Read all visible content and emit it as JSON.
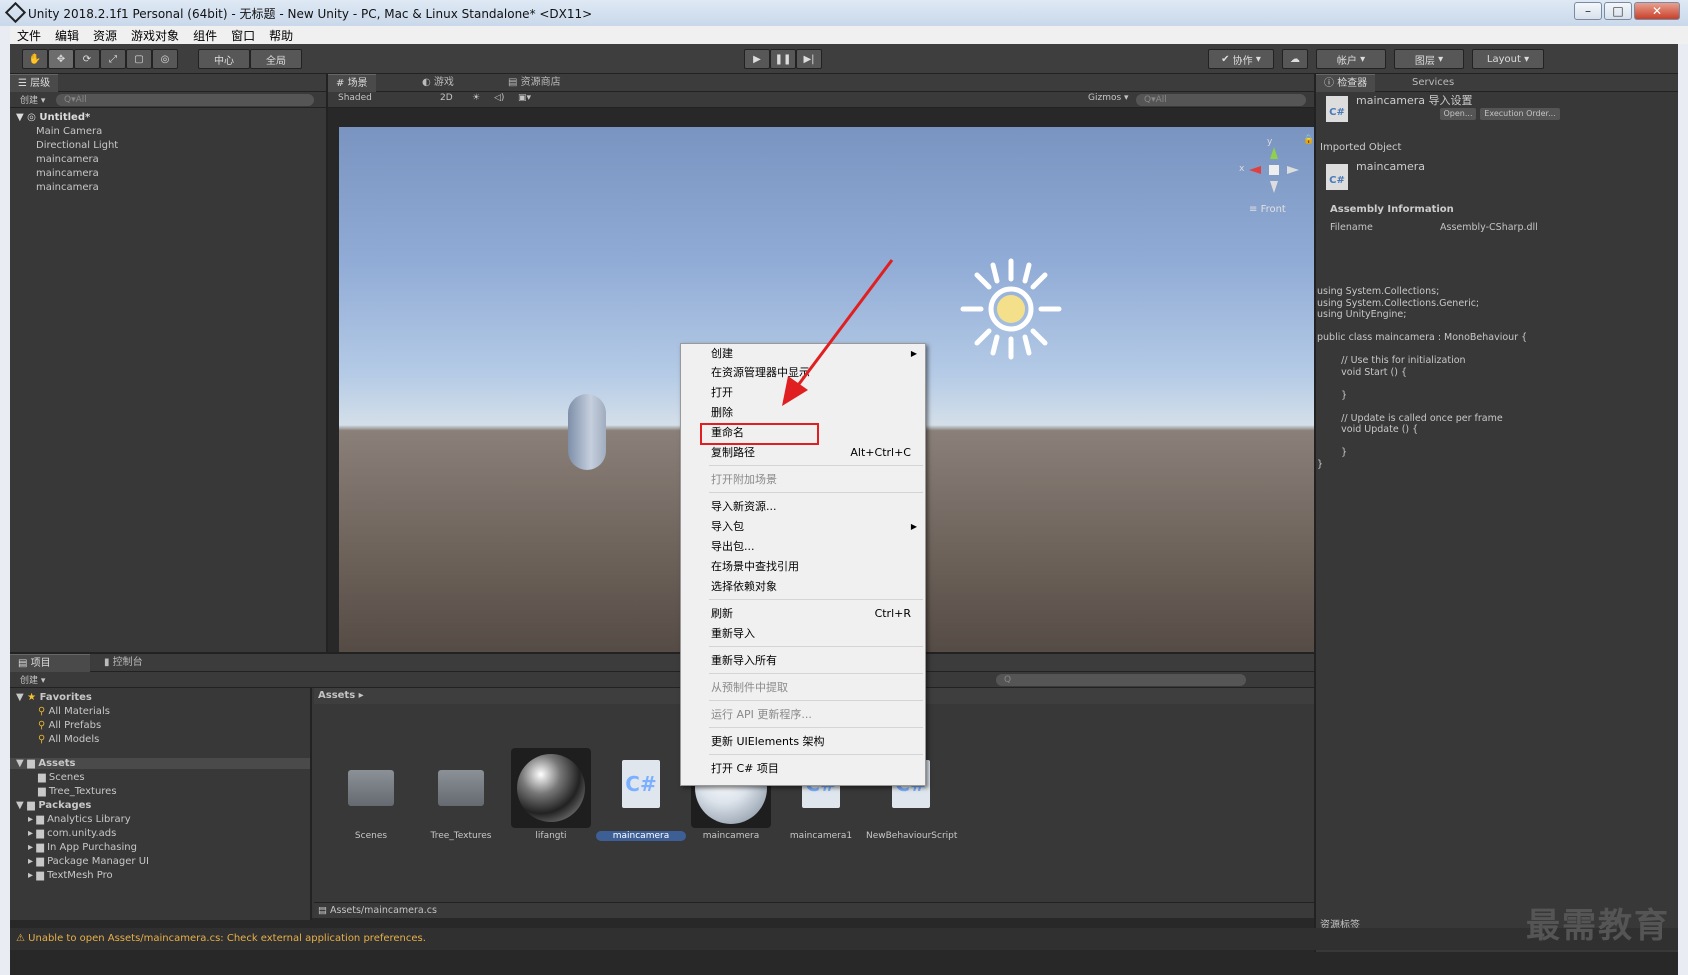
{
  "window": {
    "title": "Unity 2018.2.1f1 Personal (64bit) - 无标题 - New Unity - PC, Mac & Linux Standalone* <DX11>"
  },
  "menubar": [
    "文件",
    "编辑",
    "资源",
    "游戏对象",
    "组件",
    "窗口",
    "帮助"
  ],
  "toolbar": {
    "pivot": "中心",
    "global": "全局",
    "collab": "协作",
    "account": "帐户",
    "layers": "图层",
    "layout": "Layout"
  },
  "hierarchy": {
    "tab": "层级",
    "create": "创建",
    "search_placeholder": "All",
    "scene": "Untitled*",
    "items": [
      "Main Camera",
      "Directional Light",
      "maincamera",
      "maincamera",
      "maincamera"
    ]
  },
  "scene_tabs": {
    "scene": "场景",
    "game": "游戏",
    "store": "资源商店",
    "shading": "Shaded",
    "mode2d": "2D",
    "gizmos": "Gizmos",
    "search": "All",
    "gizmo_label": "Front",
    "axis_x": "x",
    "axis_y": "y"
  },
  "inspector": {
    "tab": "检查器",
    "services": "Services",
    "title": "maincamera 导入设置",
    "open": "Open...",
    "exec": "Execution Order...",
    "imported": "Imported Object",
    "object_name": "maincamera",
    "assembly_header": "Assembly Information",
    "filename_label": "Filename",
    "filename_value": "Assembly-CSharp.dll",
    "code": "using System.Collections;\nusing System.Collections.Generic;\nusing UnityEngine;\n\npublic class maincamera : MonoBehaviour {\n\n        // Use this for initialization\n        void Start () {\n\n        }\n\n        // Update is called once per frame\n        void Update () {\n\n        }\n}",
    "asset_labels": "资源标签"
  },
  "project": {
    "tab": "项目",
    "console": "控制台",
    "create": "创建",
    "breadcrumb": "Assets ▸",
    "favorites": {
      "title": "Favorites",
      "items": [
        "All Materials",
        "All Prefabs",
        "All Models"
      ]
    },
    "assets": {
      "title": "Assets",
      "items": [
        "Scenes",
        "Tree_Textures"
      ]
    },
    "packages": {
      "title": "Packages",
      "items": [
        "Analytics Library",
        "com.unity.ads",
        "In App Purchasing",
        "Package Manager UI",
        "TextMesh Pro"
      ]
    },
    "grid": [
      "Scenes",
      "Tree_Textures",
      "lifangti",
      "maincamera",
      "maincamera",
      "maincamera1",
      "NewBehaviourScript"
    ],
    "cs": "C#",
    "path": "Assets/maincamera.cs"
  },
  "context_menu": {
    "items": [
      {
        "label": "创建",
        "sub": true
      },
      {
        "label": "在资源管理器中显示"
      },
      {
        "label": "打开"
      },
      {
        "label": "删除"
      },
      {
        "label": "重命名"
      },
      {
        "label": "复制路径",
        "shortcut": "Alt+Ctrl+C"
      },
      {
        "label": "打开附加场景",
        "disabled": true
      },
      {
        "label": "导入新资源..."
      },
      {
        "label": "导入包",
        "sub": true
      },
      {
        "label": "导出包..."
      },
      {
        "label": "在场景中查找引用"
      },
      {
        "label": "选择依赖对象"
      },
      {
        "label": "刷新",
        "shortcut": "Ctrl+R"
      },
      {
        "label": "重新导入"
      },
      {
        "label": "重新导入所有"
      },
      {
        "label": "从预制件中提取",
        "disabled": true
      },
      {
        "label": "运行 API 更新程序...",
        "disabled": true
      },
      {
        "label": "更新 UIElements 架构"
      },
      {
        "label": "打开 C# 项目"
      }
    ]
  },
  "status": "Unable to open Assets/maincamera.cs: Check external application preferences.",
  "watermark": "最需教育",
  "colors": {
    "highlight": "#e02020",
    "selection": "#3e5f96",
    "status_warn": "#e8b04a"
  }
}
